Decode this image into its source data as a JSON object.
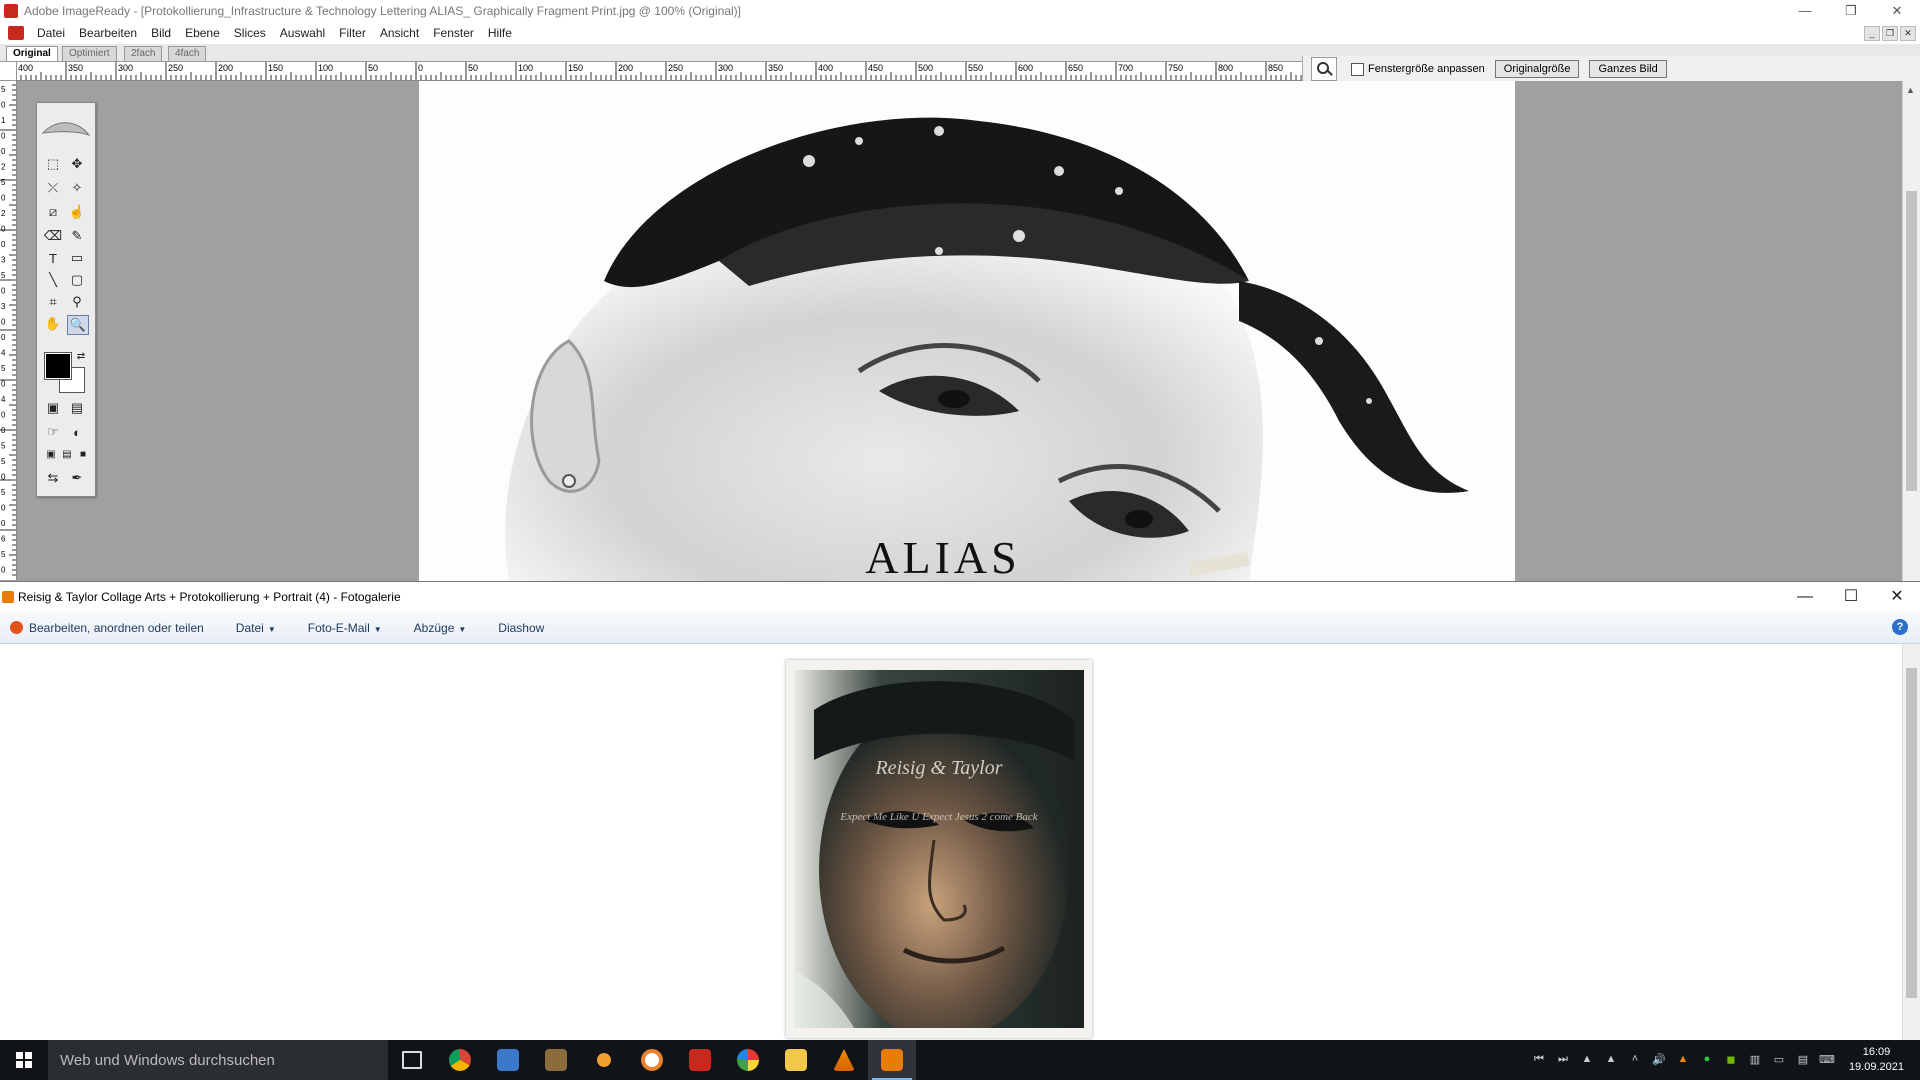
{
  "imageready": {
    "title": "Adobe ImageReady - [Protokollierung_Infrastructure & Technology Lettering ALIAS_ Graphically Fragment Print.jpg @ 100% (Original)]",
    "menu": [
      "Datei",
      "Bearbeiten",
      "Bild",
      "Ebene",
      "Slices",
      "Auswahl",
      "Filter",
      "Ansicht",
      "Fenster",
      "Hilfe"
    ],
    "tabs": [
      "Original",
      "Optimiert",
      "2fach",
      "4fach"
    ],
    "active_tab": "Original",
    "ruler_h_labels": [
      "400",
      "350",
      "300",
      "250",
      "200",
      "150",
      "100",
      "50",
      "0",
      "50",
      "100",
      "150",
      "200",
      "250",
      "300",
      "350",
      "400",
      "450",
      "500",
      "550",
      "600",
      "650",
      "700",
      "750",
      "800",
      "850"
    ],
    "ruler_v_labels": [
      "5",
      "0",
      "1",
      "0",
      "0",
      "2",
      "5",
      "0",
      "2",
      "0",
      "0",
      "3",
      "5",
      "0",
      "3",
      "0",
      "0",
      "4",
      "5",
      "0",
      "4",
      "0",
      "0",
      "5",
      "5",
      "0",
      "5",
      "0",
      "0",
      "6",
      "5",
      "0"
    ],
    "zoom_bar": {
      "fit_window_label": "Fenstergröße anpassen",
      "actual_size_label": "Originalgröße",
      "fit_image_label": "Ganzes Bild"
    },
    "image_text": "ALIAS"
  },
  "gallery": {
    "title": "Reisig & Taylor Collage Arts + Protokollierung + Portrait  (4) - Fotogalerie",
    "toolbar": {
      "edit": "Bearbeiten, anordnen oder teilen",
      "file": "Datei",
      "email": "Foto-E-Mail",
      "prints": "Abzüge",
      "slideshow": "Diashow"
    },
    "photo_script": "Reisig & Taylor",
    "photo_subtext": "Expect Me Like U Expect Jesus 2 come Back"
  },
  "taskbar": {
    "search_placeholder": "Web und Windows durchsuchen",
    "time": "16:09",
    "date": "19.09.2021"
  }
}
